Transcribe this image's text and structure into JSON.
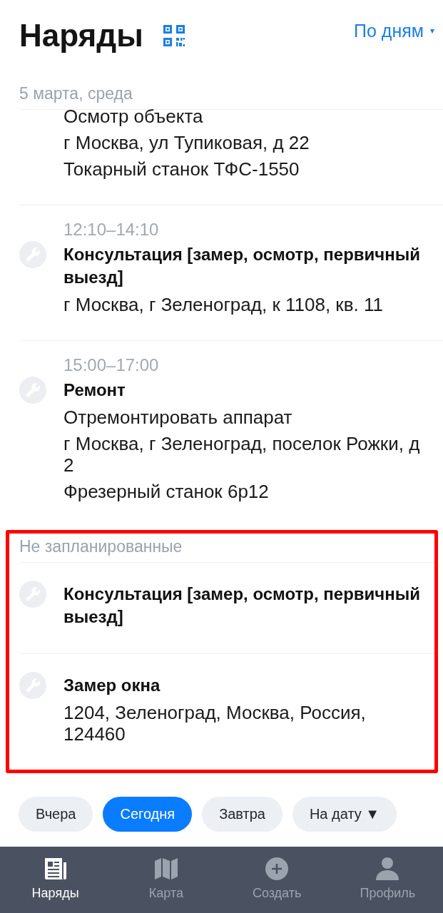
{
  "header": {
    "title": "Наряды",
    "view_mode": {
      "label": "По дням",
      "caret": "▾"
    }
  },
  "groups": [
    {
      "heading": "5 марта, среда",
      "highlighted": false,
      "orders": [
        {
          "lines": [
            "Осмотр объекта",
            "г Москва, ул Тупиковая, д 22",
            "Токарный станок ТФС-1550"
          ]
        },
        {
          "time": "12:10–14:10",
          "title": "Консультация [замер, осмотр, первичный выезд]",
          "lines": [
            "г Москва, г Зеленоград, к 1108, кв. 11"
          ]
        },
        {
          "time": "15:00–17:00",
          "title": "Ремонт",
          "lines": [
            "Отремонтировать аппарат",
            "г Москва, г Зеленоград, поселок Рожки, д 2",
            "Фрезерный станок 6р12"
          ]
        }
      ]
    },
    {
      "heading": "Не запланированные",
      "highlighted": true,
      "orders": [
        {
          "title": "Консультация [замер, осмотр, первичный выезд]"
        },
        {
          "title": "Замер окна",
          "lines": [
            "1204, Зеленоград, Москва, Россия, 124460"
          ]
        }
      ]
    }
  ],
  "day_filters": [
    {
      "label": "Вчера",
      "selected": false
    },
    {
      "label": "Сегодня",
      "selected": true
    },
    {
      "label": "Завтра",
      "selected": false
    },
    {
      "label": "На дату ▼",
      "selected": false
    }
  ],
  "bottom_nav": [
    {
      "kind": "orders",
      "label": "Наряды",
      "selected": true
    },
    {
      "kind": "map",
      "label": "Карта",
      "selected": false
    },
    {
      "kind": "create",
      "label": "Создать",
      "selected": false
    },
    {
      "kind": "profile",
      "label": "Профиль",
      "selected": false
    }
  ]
}
